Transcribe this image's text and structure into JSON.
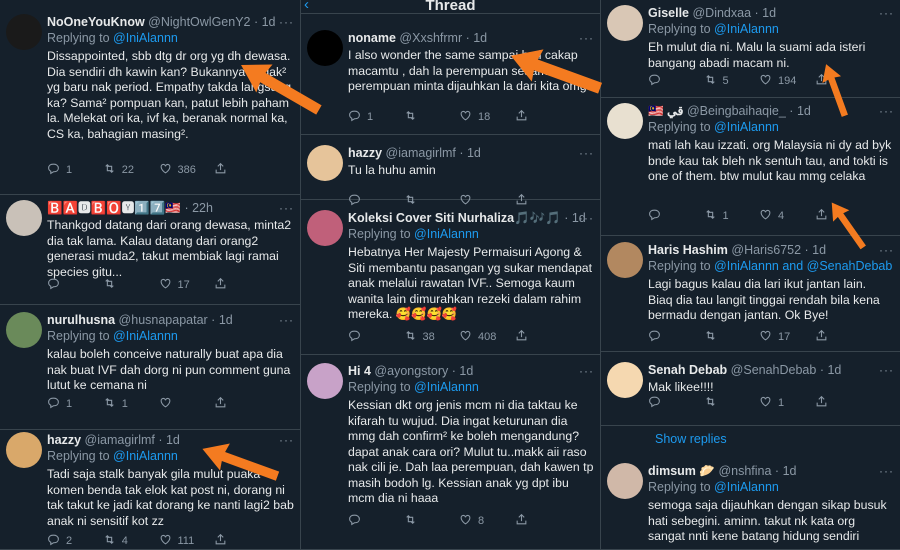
{
  "header": {
    "title": "Thread"
  },
  "left": [
    {
      "name": "NoOneYouKnow",
      "handle": "@NightOwlGenY2",
      "time": "1d",
      "replying_label": "Replying to",
      "replying_to": "@IniAlannn",
      "text": "Dissappointed, sbb dtg dr org yg dh dewasa. Dia sendiri dh kawin kan? Bukannya budak² yg baru nak period. Empathy takda langsung ka? Sama² pompuan kan, patut lebih paham la. Melekat ori ka, ivf ka, beranak normal ka, CS ka, bahagian masing².",
      "replies": "1",
      "retweets": "22",
      "likes": "386"
    },
    {
      "name": "🅱️🅰️🅳🅱️🅾️🆈1️⃣7️⃣🇲🇾",
      "handle": "",
      "time": "22h",
      "replying_label": "",
      "replying_to": "",
      "text": "Thankgod datang dari orang dewasa, minta2 dia tak lama. Kalau datang dari orang2 generasi muda2, takut membiak lagi ramai species gitu...",
      "replies": "",
      "retweets": "",
      "likes": "17"
    },
    {
      "name": "nurulhusna",
      "handle": "@husnapapatar",
      "time": "1d",
      "replying_label": "Replying to",
      "replying_to": "@IniAlannn",
      "text": "kalau boleh conceive naturally buat apa dia nak buat IVF dah dorg ni pun comment guna lutut ke cemana ni",
      "replies": "1",
      "retweets": "1",
      "likes": ""
    },
    {
      "name": "hazzy",
      "handle": "@iamagirlmf",
      "time": "1d",
      "replying_label": "Replying to",
      "replying_to": "@IniAlannn",
      "text": "Tadi saja stalk banyak gila mulut puaka komen benda tak elok kat post ni, dorang ni tak takut ke jadi kat dorang ke nanti lagi2 bab anak ni sensitif kot zz",
      "replies": "2",
      "retweets": "4",
      "likes": "111"
    }
  ],
  "mid": [
    {
      "name": "noname",
      "handle": "@Xxshfrmr",
      "time": "1d",
      "replying_label": "",
      "replying_to": "",
      "text": "I also wonder the same sampai hati cakap macamtu , dah la perempuan sesama perempuan minta dijauhkan la dari kita omg",
      "replies": "1",
      "retweets": "",
      "likes": "18"
    },
    {
      "name": "hazzy",
      "handle": "@iamagirlmf",
      "time": "1d",
      "replying_label": "",
      "replying_to": "",
      "text": "Tu la huhu amin",
      "replies": "",
      "retweets": "",
      "likes": ""
    },
    {
      "name": "Koleksi Cover Siti Nurhaliza🎵🎶🎵",
      "handle": "",
      "time": "1d",
      "replying_label": "Replying to",
      "replying_to": "@IniAlannn",
      "text": "Hebatnya Her Majesty Permaisuri Agong & Siti membantu pasangan yg sukar mendapat anak melalui rawatan IVF.. Semoga kaum wanita lain dimurahkan rezeki dalam rahim mereka. 🥰🥰🥰🥰",
      "replies": "",
      "retweets": "38",
      "likes": "408"
    },
    {
      "name": "Hi 4",
      "handle": "@ayongstory",
      "time": "1d",
      "replying_label": "Replying to",
      "replying_to": "@IniAlannn",
      "text": "Kessian dkt org jenis mcm ni dia taktau ke kifarah tu wujud. Dia ingat keturunan dia mmg dah confirm² ke boleh mengandung? dapat anak cara ori? Mulut tu..makk aii raso nak cili je. Dah laa perempuan, dah kawen tp masih bodoh lg. Kessian anak yg dpt ibu mcm dia ni haaa",
      "replies": "",
      "retweets": "",
      "likes": "8"
    }
  ],
  "right": [
    {
      "name": "Giselle",
      "handle": "@Dindxaa",
      "time": "1d",
      "replying_label": "Replying to",
      "replying_to": "@IniAlannn",
      "text": "Eh mulut dia ni. Malu la suami ada isteri bangang abadi macam ni.",
      "replies": "",
      "retweets": "5",
      "likes": "194"
    },
    {
      "name": "🇲🇾 قي",
      "handle": "@Beingbaihaqie_",
      "time": "1d",
      "replying_label": "Replying to",
      "replying_to": "@IniAlannn",
      "text": "mati lah kau izzati. org Malaysia ni dy ad byk bnde kau tak bleh nk sentuh tau, and tokti is one of them. btw mulut kau mmg celaka",
      "replies": "",
      "retweets": "1",
      "likes": "4"
    },
    {
      "name": "Haris Hashim",
      "handle": "@Haris6752",
      "time": "1d",
      "replying_label": "Replying to",
      "replying_to": "@IniAlannn and @SenahDebab",
      "text": "Lagi bagus kalau dia lari ikut jantan lain. Biaq dia tau langit tinggai rendah bila kena bermadu dengan jantan. Ok Bye!",
      "replies": "",
      "retweets": "",
      "likes": "17"
    },
    {
      "name": "Senah Debab",
      "handle": "@SenahDebab",
      "time": "1d",
      "replying_label": "",
      "replying_to": "",
      "text": "Mak likee!!!!",
      "replies": "",
      "retweets": "",
      "likes": "1"
    },
    {
      "name": "dimsum 🥟",
      "handle": "@nshfina",
      "time": "1d",
      "replying_label": "Replying to",
      "replying_to": "@IniAlannn",
      "text": "semoga saja dijauhkan dengan sikap busuk hati sebegini. aminn. takut nk kata org sangat nnti kene batang hidung sendiri",
      "replies": "",
      "retweets": "",
      "likes": ""
    }
  ],
  "show_replies": "Show replies",
  "colors": {
    "background": "#15202b",
    "link": "#1d9bf0",
    "muted": "#8b98a5",
    "arrow": "#f47b20"
  }
}
